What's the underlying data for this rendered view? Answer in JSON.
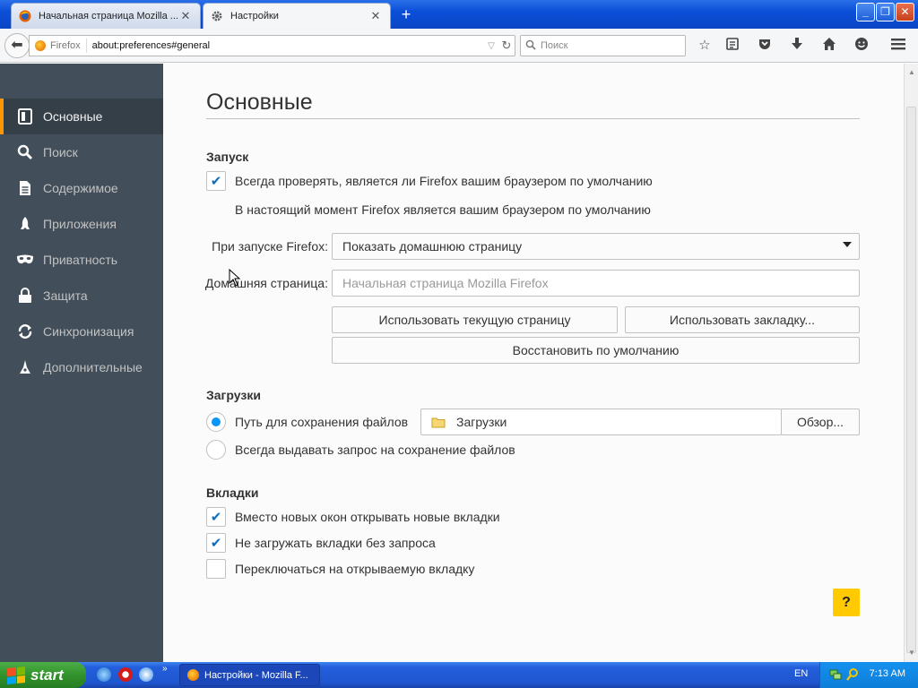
{
  "browser": {
    "tabs": [
      {
        "title": "Начальная страница Mozilla ...",
        "active": false
      },
      {
        "title": "Настройки",
        "active": true
      }
    ],
    "window_controls": {
      "minimize": "_",
      "maximize": "❐",
      "close": "✕"
    },
    "identity_label": "Firefox",
    "url": "about:preferences#general",
    "search_placeholder": "Поиск"
  },
  "sidebar": {
    "items": [
      {
        "label": "Основные",
        "icon": "general-icon",
        "selected": true
      },
      {
        "label": "Поиск",
        "icon": "search-icon"
      },
      {
        "label": "Содержимое",
        "icon": "content-icon"
      },
      {
        "label": "Приложения",
        "icon": "applications-icon"
      },
      {
        "label": "Приватность",
        "icon": "privacy-mask-icon"
      },
      {
        "label": "Защита",
        "icon": "security-lock-icon"
      },
      {
        "label": "Синхронизация",
        "icon": "sync-icon"
      },
      {
        "label": "Дополнительные",
        "icon": "advanced-icon"
      }
    ]
  },
  "main": {
    "title": "Основные",
    "startup": {
      "heading": "Запуск",
      "default_check_label": "Всегда проверять, является ли Firefox вашим браузером по умолчанию",
      "default_check_checked": true,
      "default_status": "В настоящий момент Firefox является вашим браузером по умолчанию",
      "on_start_label": "При запуске Firefox:",
      "on_start_value": "Показать домашнюю страницу",
      "homepage_label": "Домашняя страница:",
      "homepage_placeholder": "Начальная страница Mozilla Firefox",
      "use_current_button": "Использовать текущую страницу",
      "use_bookmark_button": "Использовать закладку...",
      "restore_default_button": "Восстановить по умолчанию"
    },
    "downloads": {
      "heading": "Загрузки",
      "save_path_label": "Путь для сохранения файлов",
      "save_path_selected": true,
      "folder": "Загрузки",
      "browse_button": "Обзор...",
      "always_ask_label": "Всегда выдавать запрос на сохранение файлов"
    },
    "tabs_section": {
      "heading": "Вкладки",
      "items": [
        {
          "label": "Вместо новых окон открывать новые вкладки",
          "checked": true
        },
        {
          "label": "Не загружать вкладки без запроса",
          "checked": true
        },
        {
          "label": "Переключаться на открываемую вкладку",
          "checked": false
        }
      ]
    },
    "help_button": "?"
  },
  "taskbar": {
    "start_label": "start",
    "task_label": "Настройки - Mozilla F...",
    "language": "EN",
    "clock": "7:13 AM"
  },
  "colors": {
    "sidebar_bg": "#424f5a",
    "sidebar_selected_bg": "#343f48",
    "selected_accent": "#ff9500",
    "checkmark": "#0c6dbf",
    "radio_dot": "#0996f8",
    "help_button": "#ffcb00"
  }
}
